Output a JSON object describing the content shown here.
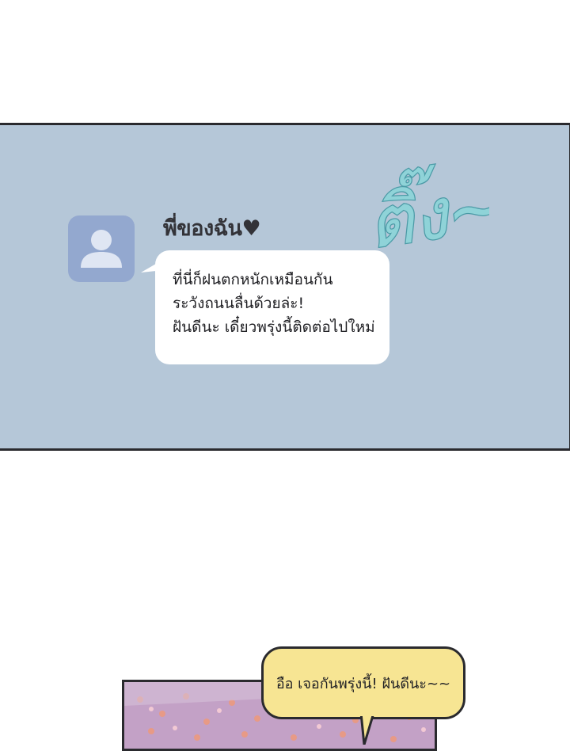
{
  "message": {
    "sender_name": "พี่ของฉัน♥",
    "avatar_icon": "person-placeholder-icon",
    "lines": [
      "ที่นี่ก็ฝนตกหนักเหมือนกัน",
      "ระวังถนนลื่นด้วยล่ะ!",
      "ฝันดีนะ เดี๋ยวพรุ่งนี้ติดต่อไปใหม่"
    ]
  },
  "sound_effect": "ติ๊ง~",
  "speech_bubble": {
    "text": "อือ เจอกันพรุ่งนี้! ฝันดีนะ~~"
  },
  "colors": {
    "panel_background": "#b5c7d8",
    "avatar_background": "#93a8cf",
    "sound_effect": "#8fd3d8",
    "speech_bubble": "#f7e593",
    "scene_background": "#c3a1c6"
  }
}
